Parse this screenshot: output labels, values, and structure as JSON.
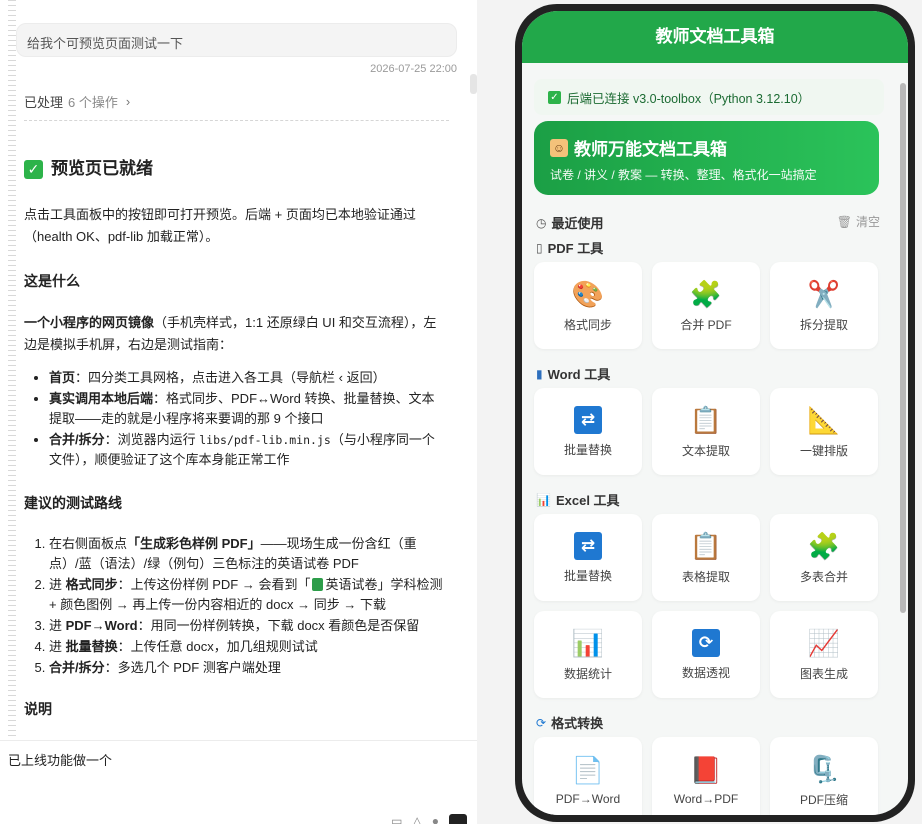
{
  "chat": {
    "user_message": "给我个可预览页面测试一下",
    "timestamp": "2026-07-25 22:00",
    "processed_label": "已处理",
    "processed_count": "6 个操作",
    "heading": "预览页已就绪",
    "intro_p1": "点击工具面板中的按钮即可打开预览。后端 + 页面均已本地验证通过（health OK、pdf-lib 加载正常）。",
    "what_title": "这是什么",
    "what_p_bold": "一个小程序的网页镜像",
    "what_p_rest": "（手机壳样式，1:1 还原绿白 UI 和交互流程），左边是模拟手机屏，右边是测试指南：",
    "bullets": [
      {
        "bold": "首页",
        "text": "：四分类工具网格，点击进入各工具（导航栏 ‹ 返回）"
      },
      {
        "bold": "真实调用本地后端",
        "text": "：格式同步、PDF↔Word 转换、批量替换、文本提取——走的就是小程序将来要调的那 9 个接口"
      },
      {
        "bold": "合并/拆分",
        "text": "：浏览器内运行 ",
        "code": "libs/pdf-lib.min.js",
        "text2": "（与小程序同一个文件），顺便验证了这个库本身能正常工作"
      }
    ],
    "route_title": "建议的测试路线",
    "steps": [
      {
        "pre": "在右侧面板点",
        "bold": "「生成彩色样例 PDF」",
        "text": "——现场生成一份含红（重点）/蓝（语法）/绿（例句）三色标注的英语试卷 PDF"
      },
      {
        "pre": "进 ",
        "bold": "格式同步",
        "text": "：上传这份样例 PDF → 会看到「",
        "inner": "英语试卷",
        "text2": "」学科检测 + 颜色图例 → 再上传一份内容相近的 docx → 同步 → 下载"
      },
      {
        "pre": "进 ",
        "bold": "PDF→Word",
        "text": "：用同一份样例转换，下载 docx 看颜色是否保留"
      },
      {
        "pre": "进 ",
        "bold": "批量替换",
        "text": "：上传任意 docx，加几组规则试试"
      },
      {
        "pre": "",
        "bold": "合并/拆分",
        "text": "：多选几个 PDF 测客户端处理"
      }
    ],
    "note_title": "说明",
    "input_text": "已上线功能做一个"
  },
  "app": {
    "nav_title": "教师文档工具箱",
    "connection": "后端已连接 v3.0-toolbox（Python 3.12.10）",
    "hero_title": "教师万能文档工具箱",
    "hero_subtitle": "试卷 / 讲义 / 教案 — 转换、整理、格式化一站搞定",
    "recent_label": "最近使用",
    "clear_label": "清空",
    "sections": {
      "pdf": "PDF 工具",
      "word": "Word 工具",
      "excel": "Excel 工具",
      "convert": "格式转换"
    },
    "pdf_tools": [
      {
        "icon": "palette-icon",
        "label": "格式同步"
      },
      {
        "icon": "puzzle-icon",
        "label": "合并 PDF"
      },
      {
        "icon": "scissors-icon",
        "label": "拆分提取"
      }
    ],
    "word_tools": [
      {
        "icon": "repeat-icon",
        "label": "批量替换"
      },
      {
        "icon": "clipboard-icon",
        "label": "文本提取"
      },
      {
        "icon": "triangle-ruler-icon",
        "label": "一键排版"
      }
    ],
    "excel_tools": [
      {
        "icon": "repeat-icon",
        "label": "批量替换"
      },
      {
        "icon": "clipboard-icon",
        "label": "表格提取"
      },
      {
        "icon": "puzzle-icon",
        "label": "多表合并"
      },
      {
        "icon": "bar-chart-icon",
        "label": "数据统计"
      },
      {
        "icon": "refresh-icon",
        "label": "数据透视"
      },
      {
        "icon": "trend-chart-icon",
        "label": "图表生成"
      }
    ],
    "convert_tools": [
      {
        "icon": "document-icon",
        "label": "PDF→Word"
      },
      {
        "icon": "red-book-icon",
        "label": "Word→PDF"
      },
      {
        "icon": "vise-icon",
        "label": "PDF压缩"
      }
    ],
    "colors": {
      "brand": "#22a84a",
      "hero_start": "#1b9f45",
      "hero_end": "#2bc35a"
    }
  }
}
